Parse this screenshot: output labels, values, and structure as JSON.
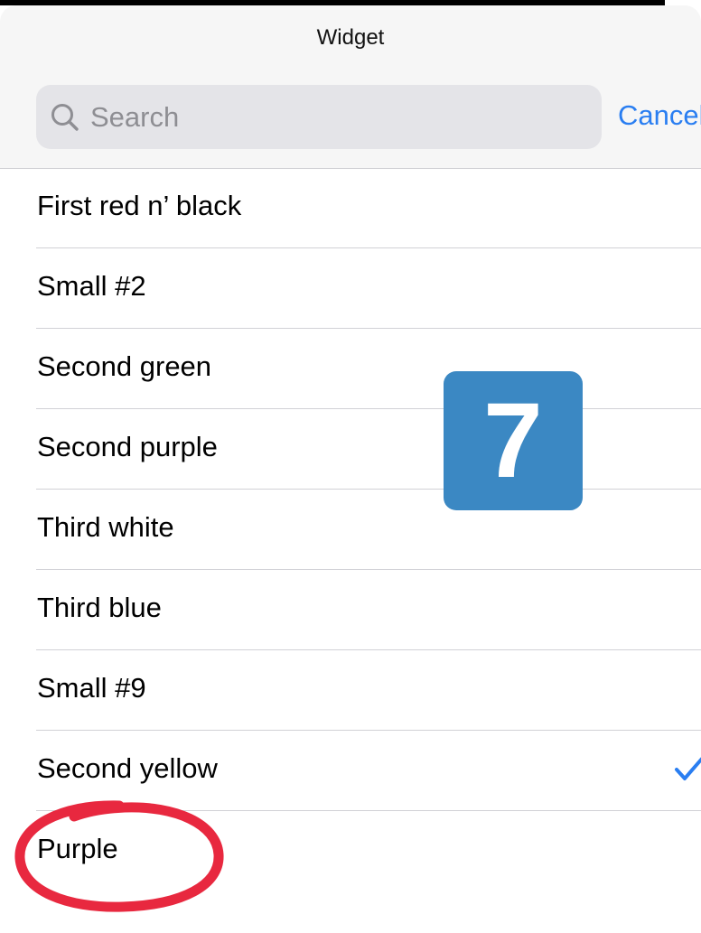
{
  "header": {
    "title": "Widget",
    "search_placeholder": "Search",
    "search_icon": "search-icon",
    "cancel_label": "Cancel"
  },
  "list": {
    "items": [
      {
        "label": "First red n’ black",
        "selected": false
      },
      {
        "label": "Small #2",
        "selected": false
      },
      {
        "label": "Second green",
        "selected": false
      },
      {
        "label": "Second purple",
        "selected": false
      },
      {
        "label": "Third white",
        "selected": false
      },
      {
        "label": "Third blue",
        "selected": false
      },
      {
        "label": "Small #9",
        "selected": false
      },
      {
        "label": "Second yellow",
        "selected": true
      },
      {
        "label": "Purple",
        "selected": false
      }
    ],
    "selected_icon": "checkmark-icon"
  },
  "overlay": {
    "badge_text": "7",
    "badge_color": "#3b88c3",
    "ring_color": "#e8283f",
    "ring_target": "Purple"
  },
  "colors": {
    "accent": "#2a7ef1",
    "header_bg": "#f6f6f6",
    "search_bg": "#e4e4e8",
    "divider": "#d1d1d6"
  }
}
